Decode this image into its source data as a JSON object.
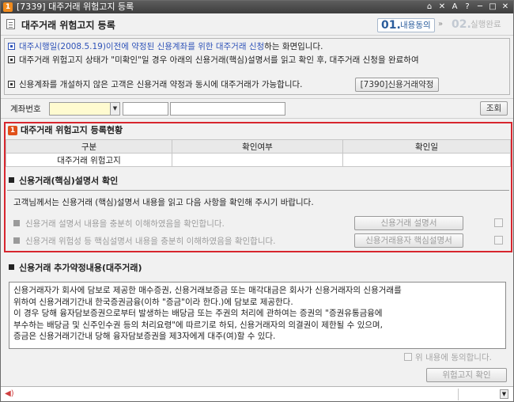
{
  "window": {
    "screen_no": "1",
    "title": "[7339] 대주거래 위험고지 등록",
    "controls": [
      "⌂",
      "✕",
      "A",
      "?",
      "─",
      "□",
      "✕"
    ]
  },
  "header": {
    "title": "대주거래 위험고지 등록",
    "step1_num": "01.",
    "step1_label": "내용동의",
    "step_arrow": "»",
    "step2_num": "02.",
    "step2_label": "실행완료"
  },
  "notice": {
    "line1_highlight": "대주시행일(2008.5.19)이전에 약정된 신용계좌를 위한 대주거래 신청",
    "line1_rest": "하는 화면입니다.",
    "line2": "대주거래 위험고지 상태가 \"미확인\"일 경우 아래의 신용거래(핵심)설명서를 읽고 확인 후, 대주거래 신청을 완료하여",
    "line3": "신용계좌를 개설하지 않은 고객은 신용거래 약정과 동시에 대주거래가 가능합니다.",
    "line3_button": "[7390]신용거래약정"
  },
  "account": {
    "label": "계좌번호",
    "selected_value": "",
    "field1_value": "",
    "field2_value": "",
    "query_button": "조회"
  },
  "status_section": {
    "badge": "1",
    "title": "대주거래 위험고지 등록현황",
    "columns": [
      "구분",
      "확인여부",
      "확인일"
    ],
    "rows": [
      [
        "대주거래 위험고지",
        "",
        ""
      ]
    ]
  },
  "explain_section": {
    "title": "신용거래(핵심)설명서 확인",
    "description": "고객님께서는 신용거래 (핵심)설명서 내용을 읽고 다음 사항을 확인해 주시기 바랍니다.",
    "check1": "신용거래 설명서 내용을 충분히 이해하였음을 확인합니다.",
    "check1_button": "신용거래 설명서",
    "check2": "신용거래 위험성 등 핵심설명서 내용을 충분히 이해하였음을 확인합니다.",
    "check2_button": "신용거래용자 핵심설명서"
  },
  "agreement_section": {
    "title": "신용거래 추가약정내용(대주거래)",
    "lines": [
      "신용거래자가 회사에 담보로 제공한 매수증권, 신용거래보증금 또는 매각대금은 회사가 신용거래자의 신용거래를",
      "위하여 신용거래기간내 한국증권금융(이하 \"증금\"이라 한다.)에 담보로 제공한다.",
      "이 경우 당해 융자담보증권으로부터 발생하는 배당금 또는 주권의 처리에 관하여는 증권의 \"증권유통금융에",
      "부수하는 배당금 및 신주인수권 등의 처리요령\"에 따르기로 하되, 신용거래자의 의결권이 제한될 수 있으며,",
      "증금은 신용거래기간내 당해 융자담보증권을 제3자에게 대주(여)할 수 있다."
    ],
    "agree_checkbox": "위 내용에 동의합니다.",
    "confirm_button": "위험고지 확인"
  },
  "statusbar": {
    "speaker_icon": "speaker-icon"
  }
}
